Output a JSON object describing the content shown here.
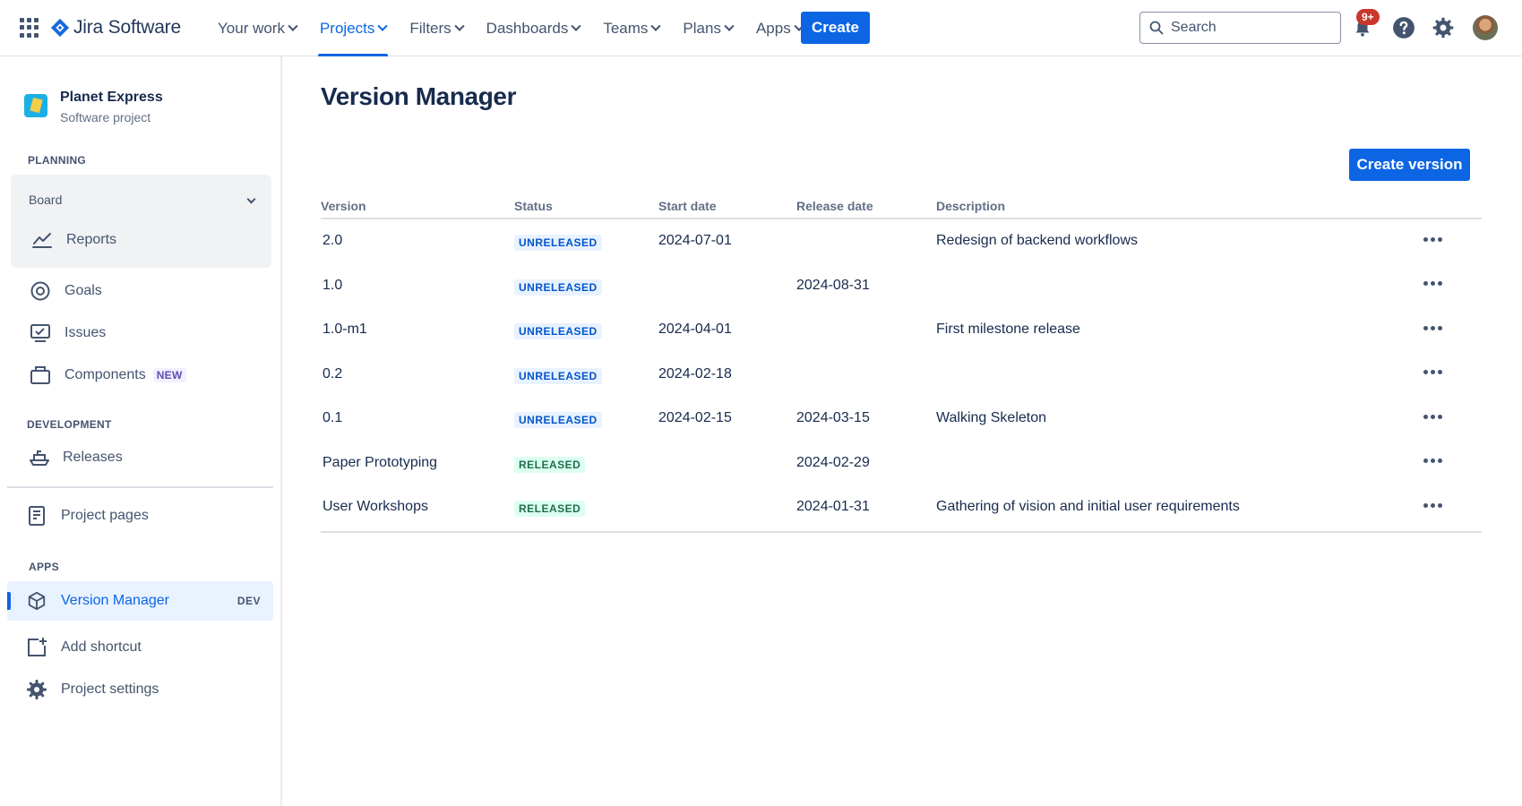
{
  "topnav": {
    "logo_text": "Jira Software",
    "items": [
      {
        "label": "Your work",
        "active": false
      },
      {
        "label": "Projects",
        "active": true
      },
      {
        "label": "Filters",
        "active": false
      },
      {
        "label": "Dashboards",
        "active": false
      },
      {
        "label": "Teams",
        "active": false
      },
      {
        "label": "Plans",
        "active": false
      },
      {
        "label": "Apps",
        "active": false
      }
    ],
    "create_label": "Create",
    "search_placeholder": "Search",
    "notifications_badge": "9+",
    "icons": [
      "app-switcher-icon",
      "jira-logo-icon",
      "search-icon",
      "notification-icon",
      "help-icon",
      "settings-icon"
    ]
  },
  "sidebar": {
    "project_name": "Planet Express",
    "project_type": "Software project",
    "planning_label": "PLANNING",
    "board_label": "Board",
    "reports_label": "Reports",
    "goals_label": "Goals",
    "issues_label": "Issues",
    "components_label": "Components",
    "components_badge": "NEW",
    "development_label": "DEVELOPMENT",
    "releases_label": "Releases",
    "project_pages_label": "Project pages",
    "apps_label": "APPS",
    "version_manager_label": "Version Manager",
    "version_manager_badge": "DEV",
    "add_shortcut_label": "Add shortcut",
    "project_settings_label": "Project settings"
  },
  "main": {
    "title": "Version Manager",
    "create_version_label": "Create version",
    "columns": {
      "version": "Version",
      "status": "Status",
      "start_date": "Start date",
      "release_date": "Release date",
      "description": "Description"
    },
    "rows": [
      {
        "version": "2.0",
        "status": "UNRELEASED",
        "start_date": "2024-07-01",
        "release_date": "",
        "description": "Redesign of backend workflows"
      },
      {
        "version": "1.0",
        "status": "UNRELEASED",
        "start_date": "",
        "release_date": "2024-08-31",
        "description": ""
      },
      {
        "version": "1.0-m1",
        "status": "UNRELEASED",
        "start_date": "2024-04-01",
        "release_date": "",
        "description": "First milestone release"
      },
      {
        "version": "0.2",
        "status": "UNRELEASED",
        "start_date": "2024-02-18",
        "release_date": "",
        "description": ""
      },
      {
        "version": "0.1",
        "status": "UNRELEASED",
        "start_date": "2024-02-15",
        "release_date": "2024-03-15",
        "description": "Walking Skeleton"
      },
      {
        "version": "Paper Prototyping",
        "status": "RELEASED",
        "start_date": "",
        "release_date": "2024-02-29",
        "description": ""
      },
      {
        "version": "User Workshops",
        "status": "RELEASED",
        "start_date": "",
        "release_date": "2024-01-31",
        "description": "Gathering of vision and initial user requirements"
      }
    ]
  },
  "colors": {
    "accent": "#0C66E4",
    "unreleased_bg": "#E9F2FF",
    "unreleased_text": "#0055CC",
    "released_bg": "#DCFFF1",
    "released_text": "#216E4E",
    "badge": "#C9372C"
  }
}
